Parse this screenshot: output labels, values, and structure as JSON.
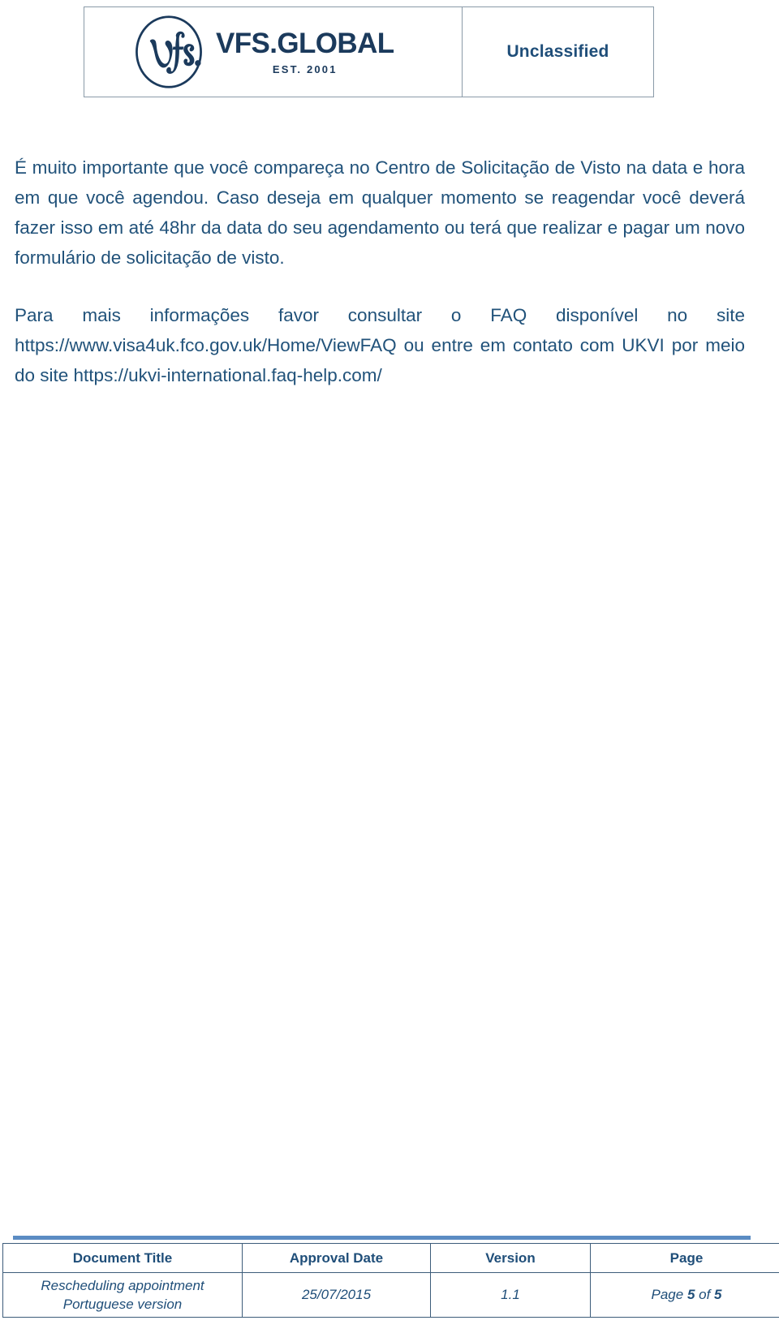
{
  "header": {
    "logo": {
      "mark_icon": "vfs-circle-logo-icon",
      "wordmark": "VFS.GLOBAL",
      "established": "EST. 2001"
    },
    "classification": "Unclassified"
  },
  "body": {
    "paragraphs": [
      "É muito importante que você compareça no Centro de Solicitação de Visto na data e hora em que você agendou.  Caso deseja em qualquer momento se reagendar você deverá fazer isso em até 48hr da data do seu agendamento ou terá que realizar e pagar um novo formulário de solicitação de visto.",
      "Para mais informações favor consultar o FAQ disponível no site https://www.visa4uk.fco.gov.uk/Home/ViewFAQ ou entre em contato com UKVI por meio do site https://ukvi-international.faq-help.com/"
    ]
  },
  "footer": {
    "headers": {
      "document_title": "Document Title",
      "approval_date": "Approval Date",
      "version": "Version",
      "page": "Page"
    },
    "values": {
      "document_title_line1": "Rescheduling appointment",
      "document_title_line2": "Portuguese version",
      "approval_date": "25/07/2015",
      "version": "1.1",
      "page_prefix": "Page ",
      "page_current": "5",
      "page_middle": " of ",
      "page_total": "5"
    }
  },
  "colors": {
    "text_blue": "#21527a",
    "heading_blue": "#1f4e79",
    "logo_navy": "#1b3a5c",
    "rule_blue": "#5b8cc3",
    "table_border": "#3d5c7a",
    "header_border": "#8a9aa8"
  }
}
